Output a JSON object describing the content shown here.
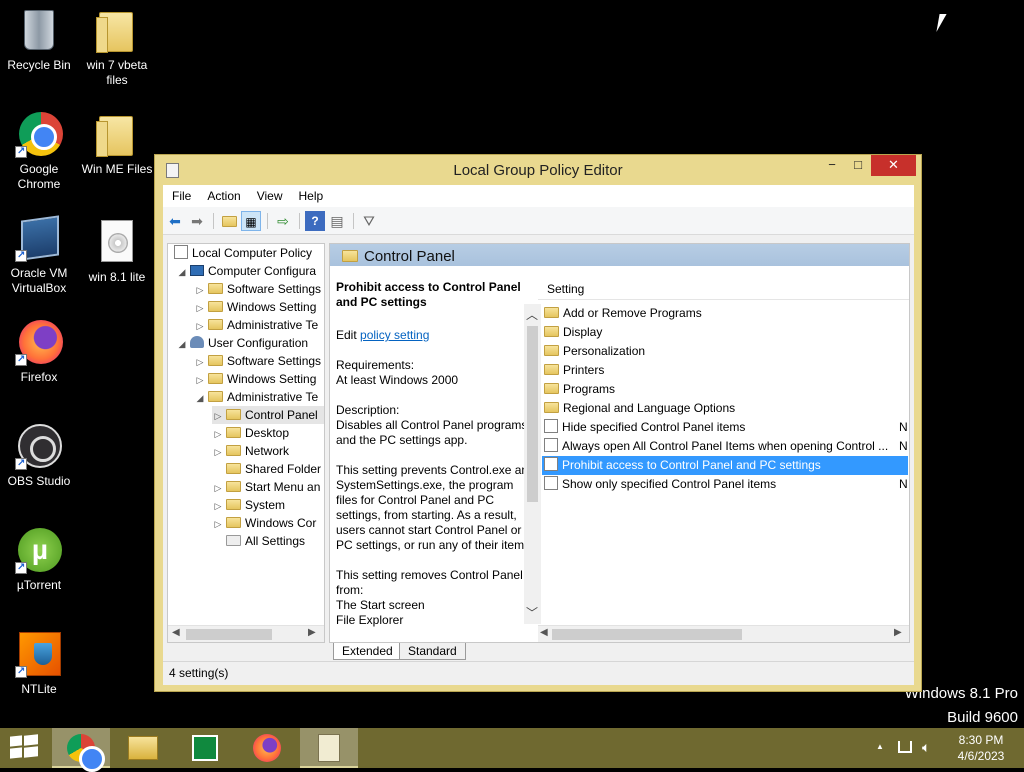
{
  "desktop": {
    "icons": [
      {
        "label": "Recycle Bin",
        "icon": "recycle-bin-icon"
      },
      {
        "label": "win 7 vbeta files",
        "icon": "folder-icon"
      },
      {
        "label": "Google Chrome",
        "icon": "chrome-icon"
      },
      {
        "label": "Win ME Files",
        "icon": "folder-icon"
      },
      {
        "label": "Oracle VM VirtualBox",
        "icon": "virtualbox-icon"
      },
      {
        "label": "win 8.1 lite",
        "icon": "disc-image-icon"
      },
      {
        "label": "Firefox",
        "icon": "firefox-icon"
      },
      {
        "label": "OBS Studio",
        "icon": "obs-icon"
      },
      {
        "label": "µTorrent",
        "icon": "utorrent-icon"
      },
      {
        "label": "NTLite",
        "icon": "ntlite-icon"
      }
    ],
    "watermark": {
      "line1": "Windows 8.1 Pro",
      "line2": "Build 9600"
    }
  },
  "window": {
    "title": "Local Group Policy Editor",
    "controls": {
      "minimize": "−",
      "maximize": "□",
      "close": "✕"
    },
    "menu": [
      "File",
      "Action",
      "View",
      "Help"
    ],
    "toolbar_icons": [
      "back-arrow-icon",
      "forward-arrow-icon",
      "up-folder-icon",
      "show-hide-tree-icon",
      "export-list-icon",
      "help-icon",
      "properties-icon",
      "filter-icon"
    ],
    "tree": [
      {
        "label": "Local Computer Policy",
        "icon": "policy-icon"
      },
      {
        "label": "Computer Configura",
        "icon": "computer-icon"
      },
      {
        "label": "Software Settings",
        "icon": "folder-icon"
      },
      {
        "label": "Windows Setting",
        "icon": "folder-icon"
      },
      {
        "label": "Administrative Te",
        "icon": "folder-icon"
      },
      {
        "label": "User Configuration",
        "icon": "user-icon"
      },
      {
        "label": "Software Settings",
        "icon": "folder-icon"
      },
      {
        "label": "Windows Setting",
        "icon": "folder-icon"
      },
      {
        "label": "Administrative Te",
        "icon": "folder-icon"
      },
      {
        "label": "Control Panel",
        "icon": "folder-icon"
      },
      {
        "label": "Desktop",
        "icon": "folder-icon"
      },
      {
        "label": "Network",
        "icon": "folder-icon"
      },
      {
        "label": "Shared Folder",
        "icon": "folder-icon"
      },
      {
        "label": "Start Menu an",
        "icon": "folder-icon"
      },
      {
        "label": "System",
        "icon": "folder-icon"
      },
      {
        "label": "Windows Cor",
        "icon": "folder-icon"
      },
      {
        "label": "All Settings",
        "icon": "all-settings-icon"
      }
    ],
    "pane_header": "Control Panel",
    "description": {
      "title": "Prohibit access to Control Panel and PC settings",
      "edit_prefix": "Edit ",
      "edit_link": "policy setting",
      "req_label": "Requirements:",
      "req_value": "At least Windows 2000",
      "desc_label": "Description:",
      "desc_1": "Disables all Control Panel programs and the PC settings app.",
      "desc_2": "This setting prevents Control.exe and SystemSettings.exe, the program files for Control Panel and PC settings, from starting. As a result, users cannot start Control Panel or PC settings, or run any of their items.",
      "desc_3": "This setting removes Control Panel from:",
      "desc_4": "The Start screen",
      "desc_5": "File Explorer"
    },
    "list_header": "Setting",
    "settings": [
      {
        "label": "Add or Remove Programs",
        "icon": "folder-icon",
        "state": ""
      },
      {
        "label": "Display",
        "icon": "folder-icon",
        "state": ""
      },
      {
        "label": "Personalization",
        "icon": "folder-icon",
        "state": ""
      },
      {
        "label": "Printers",
        "icon": "folder-icon",
        "state": ""
      },
      {
        "label": "Programs",
        "icon": "folder-icon",
        "state": ""
      },
      {
        "label": "Regional and Language Options",
        "icon": "folder-icon",
        "state": ""
      },
      {
        "label": "Hide specified Control Panel items",
        "icon": "policy-setting-icon",
        "state": "N"
      },
      {
        "label": "Always open All Control Panel Items when opening Control ...",
        "icon": "policy-setting-icon",
        "state": "N"
      },
      {
        "label": "Prohibit access to Control Panel and PC settings",
        "icon": "policy-setting-icon",
        "state": ""
      },
      {
        "label": "Show only specified Control Panel items",
        "icon": "policy-setting-icon",
        "state": "N"
      }
    ],
    "tabs": [
      "Extended",
      "Standard"
    ],
    "status": "4 setting(s)"
  },
  "taskbar": {
    "items": [
      "start-icon",
      "chrome-icon",
      "file-explorer-icon",
      "store-icon",
      "firefox-icon",
      "group-policy-editor-icon"
    ],
    "tray": {
      "chevron": "▲",
      "network": "network-icon",
      "volume": "volume-icon"
    },
    "time": "8:30 PM",
    "date": "4/6/2023"
  }
}
